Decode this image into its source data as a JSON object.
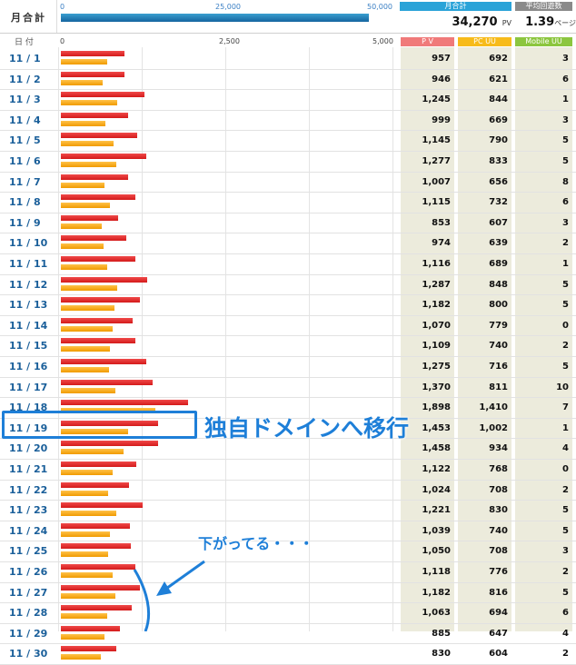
{
  "summary": {
    "label": "月合計",
    "axis_ticks": [
      "0",
      "25,000",
      "50,000"
    ],
    "monthly_pv": 34270,
    "axis_max": 50000,
    "pv_badge": "月合計",
    "pv_value": "34,270",
    "pv_unit": "PV",
    "avg_badge": "平均回遊数",
    "avg_value": "1.39",
    "avg_unit": "ページ"
  },
  "table": {
    "date_header": "日 付",
    "axis_ticks": [
      "0",
      "2,500",
      "5,000"
    ],
    "axis_max": 5000,
    "col_pv": "P V",
    "col_pcuu": "PC UU",
    "col_mobile": "Mobile UU",
    "colors": {
      "pv_bar": "#e8282a",
      "uu_bar": "#f7a600",
      "pv_head": "#f07a7a",
      "pcuu_head": "#f7bb1a",
      "mobile_head": "#8cc63f"
    },
    "rows": [
      {
        "date": "11 / 1",
        "pv": "957",
        "pcuu": "692",
        "mobile": "3"
      },
      {
        "date": "11 / 2",
        "pv": "946",
        "pcuu": "621",
        "mobile": "6"
      },
      {
        "date": "11 / 3",
        "pv": "1,245",
        "pcuu": "844",
        "mobile": "1"
      },
      {
        "date": "11 / 4",
        "pv": "999",
        "pcuu": "669",
        "mobile": "3"
      },
      {
        "date": "11 / 5",
        "pv": "1,145",
        "pcuu": "790",
        "mobile": "5"
      },
      {
        "date": "11 / 6",
        "pv": "1,277",
        "pcuu": "833",
        "mobile": "5"
      },
      {
        "date": "11 / 7",
        "pv": "1,007",
        "pcuu": "656",
        "mobile": "8"
      },
      {
        "date": "11 / 8",
        "pv": "1,115",
        "pcuu": "732",
        "mobile": "6"
      },
      {
        "date": "11 / 9",
        "pv": "853",
        "pcuu": "607",
        "mobile": "3"
      },
      {
        "date": "11 / 10",
        "pv": "974",
        "pcuu": "639",
        "mobile": "2"
      },
      {
        "date": "11 / 11",
        "pv": "1,116",
        "pcuu": "689",
        "mobile": "1"
      },
      {
        "date": "11 / 12",
        "pv": "1,287",
        "pcuu": "848",
        "mobile": "5"
      },
      {
        "date": "11 / 13",
        "pv": "1,182",
        "pcuu": "800",
        "mobile": "5"
      },
      {
        "date": "11 / 14",
        "pv": "1,070",
        "pcuu": "779",
        "mobile": "0"
      },
      {
        "date": "11 / 15",
        "pv": "1,109",
        "pcuu": "740",
        "mobile": "2"
      },
      {
        "date": "11 / 16",
        "pv": "1,275",
        "pcuu": "716",
        "mobile": "5"
      },
      {
        "date": "11 / 17",
        "pv": "1,370",
        "pcuu": "811",
        "mobile": "10"
      },
      {
        "date": "11 / 18",
        "pv": "1,898",
        "pcuu": "1,410",
        "mobile": "7"
      },
      {
        "date": "11 / 19",
        "pv": "1,453",
        "pcuu": "1,002",
        "mobile": "1"
      },
      {
        "date": "11 / 20",
        "pv": "1,458",
        "pcuu": "934",
        "mobile": "4"
      },
      {
        "date": "11 / 21",
        "pv": "1,122",
        "pcuu": "768",
        "mobile": "0"
      },
      {
        "date": "11 / 22",
        "pv": "1,024",
        "pcuu": "708",
        "mobile": "2"
      },
      {
        "date": "11 / 23",
        "pv": "1,221",
        "pcuu": "830",
        "mobile": "5"
      },
      {
        "date": "11 / 24",
        "pv": "1,039",
        "pcuu": "740",
        "mobile": "5"
      },
      {
        "date": "11 / 25",
        "pv": "1,050",
        "pcuu": "708",
        "mobile": "3"
      },
      {
        "date": "11 / 26",
        "pv": "1,118",
        "pcuu": "776",
        "mobile": "2"
      },
      {
        "date": "11 / 27",
        "pv": "1,182",
        "pcuu": "816",
        "mobile": "5"
      },
      {
        "date": "11 / 28",
        "pv": "1,063",
        "pcuu": "694",
        "mobile": "6"
      },
      {
        "date": "11 / 29",
        "pv": "885",
        "pcuu": "647",
        "mobile": "4"
      },
      {
        "date": "11 / 30",
        "pv": "830",
        "pcuu": "604",
        "mobile": "2"
      }
    ]
  },
  "annotations": {
    "domain_move": "独自ドメインへ移行",
    "going_down": "下がってる・・・",
    "color": "#1e7fd8"
  }
}
